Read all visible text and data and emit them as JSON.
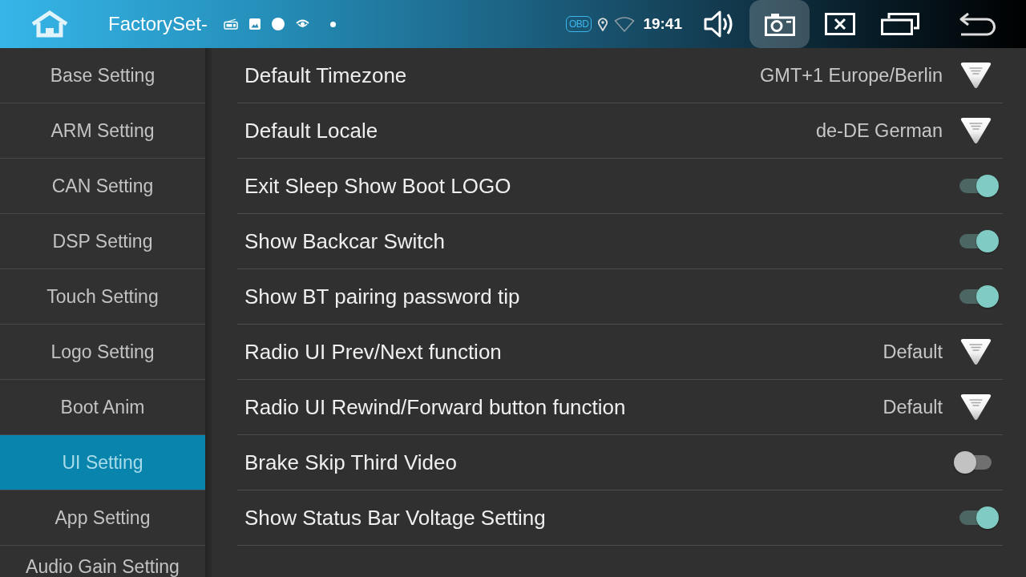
{
  "top_bar": {
    "title": "FactorySet-",
    "obd_badge": "OBD",
    "time": "19:41",
    "nav_buttons": [
      {
        "pressed": false
      },
      {
        "pressed": true
      },
      {
        "pressed": false
      },
      {
        "pressed": false
      },
      {
        "pressed": false
      }
    ]
  },
  "sidebar": {
    "items": [
      {
        "label": "Base Setting",
        "selected": false
      },
      {
        "label": "ARM Setting",
        "selected": false
      },
      {
        "label": "CAN Setting",
        "selected": false
      },
      {
        "label": "DSP Setting",
        "selected": false
      },
      {
        "label": "Touch Setting",
        "selected": false
      },
      {
        "label": "Logo Setting",
        "selected": false
      },
      {
        "label": "Boot Anim",
        "selected": false
      },
      {
        "label": "UI Setting",
        "selected": true
      },
      {
        "label": "App Setting",
        "selected": false
      },
      {
        "label": "Audio Gain Setting",
        "selected": false
      }
    ]
  },
  "settings": [
    {
      "label": "Default Timezone",
      "kind": "dropdown",
      "value": "GMT+1 Europe/Berlin"
    },
    {
      "label": "Default Locale",
      "kind": "dropdown",
      "value": "de-DE German"
    },
    {
      "label": "Exit Sleep Show Boot LOGO",
      "kind": "toggle",
      "on": true
    },
    {
      "label": "Show Backcar Switch",
      "kind": "toggle",
      "on": true
    },
    {
      "label": "Show BT pairing password tip",
      "kind": "toggle",
      "on": true
    },
    {
      "label": "Radio UI Prev/Next function",
      "kind": "dropdown",
      "value": "Default"
    },
    {
      "label": "Radio UI Rewind/Forward button function",
      "kind": "dropdown",
      "value": "Default"
    },
    {
      "label": "Brake Skip Third Video",
      "kind": "toggle",
      "on": false
    },
    {
      "label": "Show Status Bar Voltage Setting",
      "kind": "toggle",
      "on": true
    }
  ]
}
